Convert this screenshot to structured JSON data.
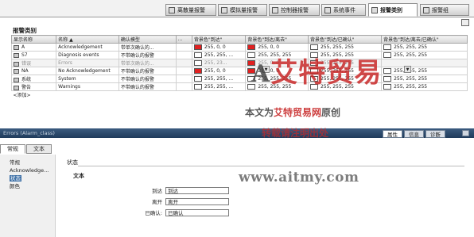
{
  "tabs": [
    {
      "label": "离散量报警",
      "active": false
    },
    {
      "label": "模拟量报警",
      "active": false
    },
    {
      "label": "控制器报警",
      "active": false
    },
    {
      "label": "系统事件",
      "active": false
    },
    {
      "label": "报警类别",
      "active": true
    },
    {
      "label": "报警组",
      "active": false
    }
  ],
  "section_title": "报警类别",
  "columns": [
    "显示名称",
    "名称 ▲",
    "确认模型",
    "...",
    "背景色\"到达\"",
    "背景色\"到达/离去\"",
    "背景色\"到达/已确认\"",
    "背景色\"到达/离去/已确认\""
  ],
  "rows": [
    {
      "display": "A",
      "name": "Acknowledgement",
      "model": "带单次确认的...",
      "c1": "255, 0, 0",
      "c2": "255, 0, 0",
      "c3": "255, 255, 255",
      "c4": "255, 255, 255",
      "dim": false
    },
    {
      "display": "S7",
      "name": "Diagnosis events",
      "model": "不带确认的报警",
      "c1": "255, 255, ...",
      "c2": "255, 255, 255",
      "c3": "255, 255, 255",
      "c4": "255, 255, 255",
      "dim": false
    },
    {
      "display": "错误",
      "name": "Errors",
      "model": "带单次确认的...",
      "c1": "255, 23...",
      "c2": "255, 0, 0",
      "c3": "255, 255, 255",
      "c4": "",
      "dim": true
    },
    {
      "display": "NA",
      "name": "No Acknowledgement",
      "model": "不带确认的报警",
      "c1": "255, 0, 0",
      "c2": "255, 0, 0",
      "c3": "255, 255, 255",
      "c4": "255, 255, 255",
      "dim": false
    },
    {
      "display": "系统",
      "name": "System",
      "model": "不带确认的报警",
      "c1": "255, 255, ...",
      "c2": "255, 255, 255",
      "c3": "255, 255, 255",
      "c4": "255, 255, 255",
      "dim": false
    },
    {
      "display": "警告",
      "name": "Warnings",
      "model": "不带确认的报警",
      "c1": "255, 255, ...",
      "c2": "255, 255, 255",
      "c3": "255, 255, 255",
      "c4": "255, 255, 255",
      "dim": false
    }
  ],
  "add_row_label": "<添加>",
  "colors": {
    "red": "#e02020",
    "white": "#ffffff",
    "pale": "#f3f3f3"
  },
  "watermark": {
    "logo_a": "A",
    "logo_text": "艾特贸易",
    "line1_prefix": "本文为",
    "line1_brand": "艾特贸易网",
    "line1_suffix": "原创",
    "line2": "转载请注明出处",
    "url": "www.aitmy.com"
  },
  "inspector": {
    "title": "Errors (Alarm_class)",
    "tabs": [
      {
        "label": "属性",
        "active": true
      },
      {
        "label": "信息",
        "active": false
      },
      {
        "label": "诊断",
        "active": false
      }
    ]
  },
  "subtabs": [
    {
      "label": "常规",
      "active": true
    },
    {
      "label": "文本",
      "active": false
    }
  ],
  "leftnav": [
    {
      "label": "常规",
      "selected": false
    },
    {
      "label": "Acknowledge...",
      "selected": false
    },
    {
      "label": "状态",
      "selected": true
    },
    {
      "label": "颜色",
      "selected": false
    }
  ],
  "status_heading": "状态",
  "text_heading": "文本",
  "fields": [
    {
      "label": "到达",
      "value": "到达"
    },
    {
      "label": "离开",
      "value": "离开"
    },
    {
      "label": "已确认:",
      "value": "已确认"
    }
  ]
}
